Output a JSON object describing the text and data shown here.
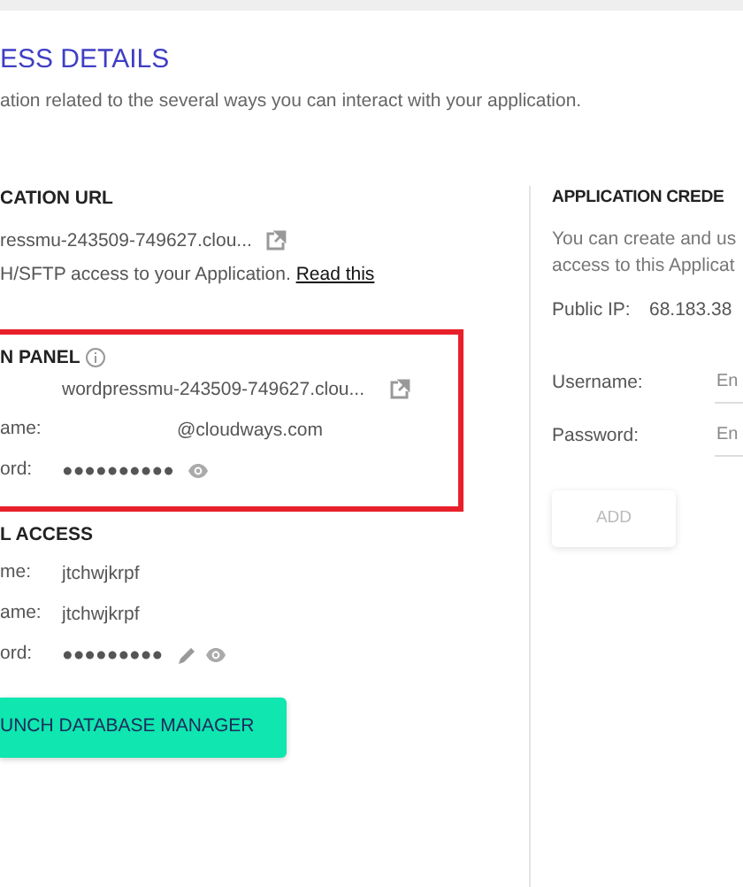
{
  "header": {
    "title": "ESS DETAILS",
    "subtitle": "ation related to the several ways you can interact with your application."
  },
  "app_url": {
    "heading": "CATION URL",
    "url": "ressmu-243509-749627.clou...",
    "note": "H/SFTP access to your Application.",
    "link": "Read this"
  },
  "admin_panel": {
    "heading": "N PANEL",
    "highlighted": true,
    "url": "wordpressmu-243509-749627.clou...",
    "rows": [
      {
        "label": "ame:",
        "value": "@cloudways.com",
        "kind": "text"
      },
      {
        "label": "ord:",
        "value": "●●●●●●●●●●",
        "kind": "password"
      }
    ]
  },
  "db_access": {
    "heading": "L ACCESS",
    "rows": [
      {
        "label": "me:",
        "value": "jtchwjkrpf",
        "kind": "text"
      },
      {
        "label": "ame:",
        "value": "jtchwjkrpf",
        "kind": "text"
      },
      {
        "label": "ord:",
        "value": "●●●●●●●●●",
        "kind": "password-edit"
      }
    ],
    "button": "UNCH DATABASE MANAGER"
  },
  "credentials": {
    "heading": "APPLICATION CREDE",
    "description": [
      "You can create and us",
      "access to this Applicat"
    ],
    "public_ip_label": "Public IP:",
    "public_ip": "68.183.38",
    "fields": [
      {
        "label": "Username:",
        "placeholder": "En"
      },
      {
        "label": "Password:",
        "placeholder": "En"
      }
    ],
    "button": {
      "label": "ADD",
      "disabled": true
    }
  }
}
